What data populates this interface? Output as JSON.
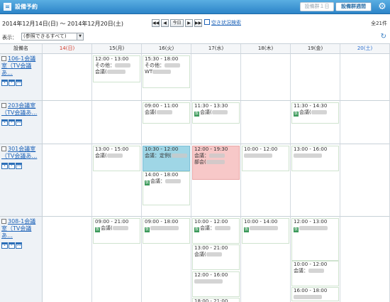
{
  "title": {
    "app_title": "設備予約",
    "btn_facility_day": "設備群１日",
    "btn_facility_week": "設備群週間"
  },
  "nav": {
    "date_range": "2014年12月14日(日) 〜 2014年12月20日(土)",
    "first": "◀◀",
    "prev": "◀",
    "today": "今日",
    "next": "▶",
    "last": "▶▶",
    "search_link": "空き状況検索",
    "total": "全21件"
  },
  "filter": {
    "label": "表示：",
    "selected": "(参照できるすべて)"
  },
  "grid": {
    "col_header_room": "設備名",
    "days": [
      {
        "label": "14(日)",
        "kind": "sun"
      },
      {
        "label": "15(月)",
        "kind": "wd"
      },
      {
        "label": "16(火)",
        "kind": "wd"
      },
      {
        "label": "17(水)",
        "kind": "wd"
      },
      {
        "label": "18(木)",
        "kind": "wd"
      },
      {
        "label": "19(金)",
        "kind": "wd"
      },
      {
        "label": "20(土)",
        "kind": "sat"
      }
    ],
    "rooms": [
      {
        "name_line1": "106-1会議",
        "name_line2": "室（TV会議あ",
        "name_line3": "…"
      },
      {
        "name_line1": "203会議室",
        "name_line2": "（TV会議あ",
        "name_line3": "…"
      },
      {
        "name_line1": "301会議室",
        "name_line2": "（TV会議あ",
        "name_line3": "…"
      },
      {
        "name_line1": "308-1会議",
        "name_line2": "室（TV会議あ",
        "name_line3": "…"
      }
    ]
  },
  "events": [
    {
      "time": "12:00 - 13:00",
      "l2": "その他：",
      "l3": "会議("
    },
    {
      "time": "15:30 - 18:00",
      "l2": "その他：",
      "l3": "WT"
    },
    {
      "time": "09:00 - 11:00",
      "l2": "会議("
    },
    {
      "time": "11:30 - 13:30",
      "l2": "会議("
    },
    {
      "time": "11:30 - 14:30",
      "l2": "会議("
    },
    {
      "time": "13:00 - 15:00",
      "l2": "会議("
    },
    {
      "time": "10:30 - 12:00",
      "l2": "会議：定例("
    },
    {
      "time": "14:00 - 18:00",
      "l2": "会議："
    },
    {
      "time": "12:00 - 19:30",
      "l2": "会議：",
      "l3": "部会("
    },
    {
      "time": "10:00 - 12:00",
      "l2": ""
    },
    {
      "time": "13:00 - 16:00",
      "l2": ""
    },
    {
      "time": "09:00 - 21:00",
      "l2": "会議("
    },
    {
      "time": "09:00 - 18:00",
      "l2": ""
    },
    {
      "time": "10:00 - 12:00",
      "l2": "会議："
    },
    {
      "time": "10:00 - 14:00",
      "l2": ""
    },
    {
      "time": "12:00 - 13:00",
      "l2": ""
    },
    {
      "time": "13:00 - 21:00",
      "l2": "会議("
    },
    {
      "time": "10:00 - 12:00",
      "l2": "会議："
    },
    {
      "time": "12:00 - 16:00",
      "l2": ""
    },
    {
      "time": "16:00 - 18:00",
      "l2": ""
    },
    {
      "time": "18:00 - 21:00",
      "l2": ""
    }
  ],
  "colors": {
    "accent": "#2c84c8",
    "sunday": "#d23a2a",
    "saturday": "#2a6ed0",
    "event_blue": "#9fd6e6",
    "event_pink": "#f7c8c8",
    "tag_green": "#3c9a5b"
  },
  "icons": {
    "settings": "gear-icon",
    "calendar": "calendar-icon",
    "refresh": "refresh-icon"
  }
}
